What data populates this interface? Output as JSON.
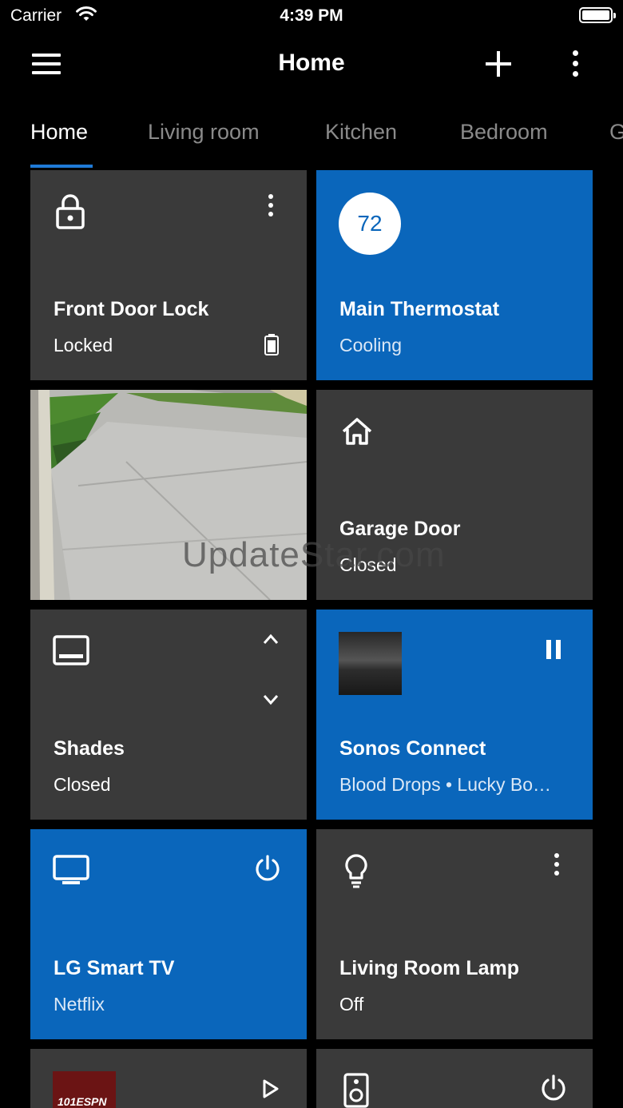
{
  "status_bar": {
    "carrier": "Carrier",
    "time": "4:39 PM"
  },
  "header": {
    "title": "Home"
  },
  "tabs": [
    {
      "label": "Home",
      "active": true
    },
    {
      "label": "Living room",
      "active": false
    },
    {
      "label": "Kitchen",
      "active": false
    },
    {
      "label": "Bedroom",
      "active": false
    },
    {
      "label": "G",
      "active": false
    }
  ],
  "tiles": {
    "front_door_lock": {
      "title": "Front Door Lock",
      "status": "Locked"
    },
    "main_thermostat": {
      "title": "Main Thermostat",
      "status": "Cooling",
      "temperature": "72"
    },
    "garage_door": {
      "title": "Garage Door",
      "status": "Closed"
    },
    "shades": {
      "title": "Shades",
      "status": "Closed"
    },
    "sonos_connect": {
      "title": "Sonos Connect",
      "status": "Blood Drops • Lucky Bo…"
    },
    "lg_smart_tv": {
      "title": "LG Smart TV",
      "status": "Netflix"
    },
    "living_room_lamp": {
      "title": "Living Room Lamp",
      "status": "Off"
    },
    "espn_album_text": "101ESPN"
  },
  "watermark": "UpdateStar.com",
  "colors": {
    "accent": "#0a66bb",
    "tile": "#3a3a3a",
    "background": "#000000",
    "tab_indicator": "#1f7ad6"
  }
}
